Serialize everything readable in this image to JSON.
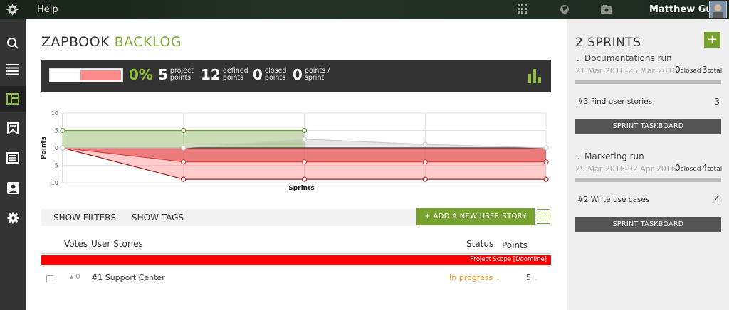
{
  "topbar": {
    "help_label": "Help",
    "user_name": "Matthew Guay",
    "icons": [
      "taiga-logo-icon",
      "apps-grid-icon",
      "globe-icon",
      "camera-icon",
      "avatar"
    ]
  },
  "leftnav": {
    "icons": [
      "search-icon",
      "backlog-list-icon",
      "kanban-icon",
      "wiki-icon",
      "issues-icon",
      "team-icon",
      "settings-icon"
    ],
    "active": "kanban-icon"
  },
  "header": {
    "title_part1": "ZAPBOOK",
    "title_part2": "BACKLOG"
  },
  "stats": {
    "progress_percent": "0%",
    "progress_fill_fraction": 0.56,
    "project_points": {
      "value": "5",
      "label_line1": "project",
      "label_line2": "points"
    },
    "defined_points": {
      "value": "12",
      "label_line1": "defined",
      "label_line2": "points"
    },
    "closed_points": {
      "value": "0",
      "label_line1": "closed",
      "label_line2": "points"
    },
    "points_sprint": {
      "value": "0",
      "label_line1": "points /",
      "label_line2": "sprint"
    }
  },
  "chart_data": {
    "type": "area",
    "xlabel": "Sprints",
    "ylabel": "Points",
    "ylim": [
      -10,
      10
    ],
    "yticks": [
      10,
      5,
      0,
      -5,
      -10
    ],
    "grid": true,
    "x": [
      0,
      1,
      2,
      3,
      4
    ],
    "series": [
      {
        "values": [
          5,
          5,
          5,
          null,
          null
        ],
        "color": "#6f9a3a"
      },
      {
        "values": [
          0,
          -4,
          -4,
          -4,
          -4
        ],
        "color": "#e04040"
      },
      {
        "values": [
          0,
          -9,
          -9,
          -9,
          -9
        ],
        "color": "#a02020"
      },
      {
        "values": [
          0,
          0,
          2.5,
          1,
          0
        ],
        "color": "#cccccc"
      }
    ]
  },
  "filters": {
    "show_filters": "SHOW FILTERS",
    "show_tags": "SHOW TAGS",
    "add_story": "+ ADD A NEW USER STORY"
  },
  "table": {
    "col_votes": "Votes",
    "col_stories": "User Stories",
    "col_status": "Status",
    "col_points": "Points",
    "scope_label": "Project Scope [Doomline]",
    "rows": [
      {
        "votes": "0",
        "story": "#1 Support Center",
        "status": "In progress",
        "points": "5"
      }
    ]
  },
  "sprints": {
    "title": "2 SPRINTS",
    "add_label": "+",
    "items": [
      {
        "name": "Documentations run",
        "dates": "21 Mar 2016-26 Mar 2016",
        "closed": "0",
        "closed_label": "closed",
        "total": "3",
        "total_label": "total",
        "story": "#3 Find user stories",
        "story_points": "3",
        "taskboard": "SPRINT TASKBOARD"
      },
      {
        "name": "Marketing run",
        "dates": "29 Mar 2016-02 Apr 2016",
        "closed": "0",
        "closed_label": "closed",
        "total": "4",
        "total_label": "total",
        "story": "#2 Write use cases",
        "story_points": "4",
        "taskboard": "SPRINT TASKBOARD"
      }
    ]
  }
}
